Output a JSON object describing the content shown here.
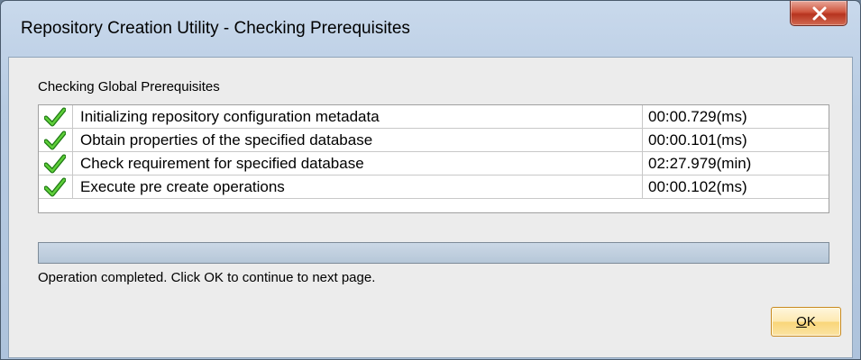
{
  "window": {
    "title": "Repository Creation Utility - Checking Prerequisites",
    "close_icon": "close-x-icon"
  },
  "section": {
    "label": "Checking Global Prerequisites"
  },
  "tasks": [
    {
      "icon": "green-checkmark-icon",
      "name": "Initializing repository configuration metadata",
      "time": "00:00.729(ms)"
    },
    {
      "icon": "green-checkmark-icon",
      "name": "Obtain properties of the specified database",
      "time": "00:00.101(ms)"
    },
    {
      "icon": "green-checkmark-icon",
      "name": "Check requirement for specified database",
      "time": "02:27.979(min)"
    },
    {
      "icon": "green-checkmark-icon",
      "name": "Execute pre create operations",
      "time": "00:00.102(ms)"
    }
  ],
  "progress": {
    "fraction": 1.0
  },
  "status": {
    "text": "Operation completed. Click OK to continue to next page."
  },
  "buttons": {
    "ok_mnemonic": "O",
    "ok_rest": "K"
  },
  "colors": {
    "check_green": "#2e9e1f",
    "close_red": "#c8412a",
    "button_amber": "#f9d67a"
  }
}
